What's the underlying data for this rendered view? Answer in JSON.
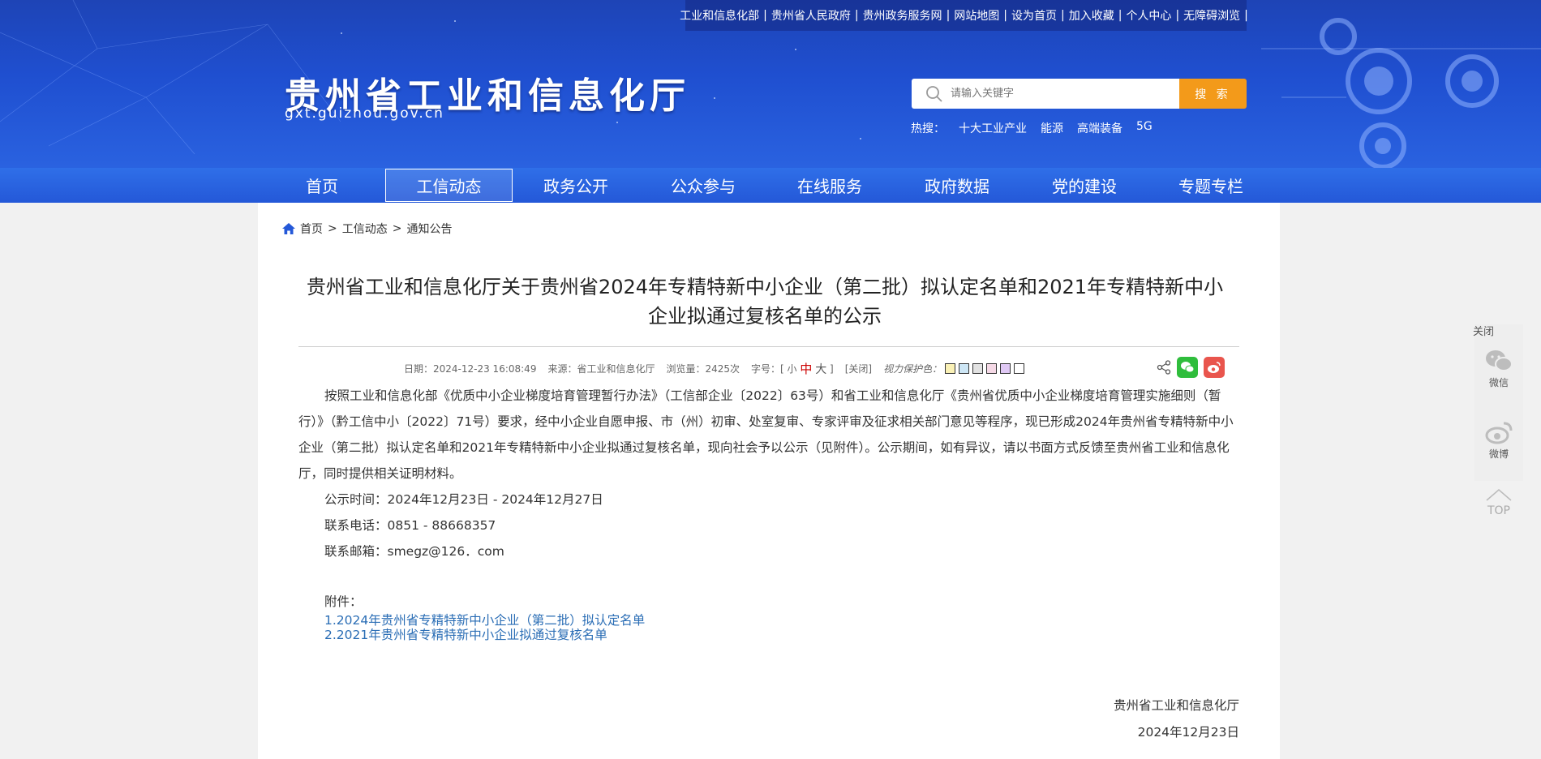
{
  "top_links": [
    "工业和信息化部",
    "贵州省人民政府",
    "贵州政务服务网",
    "网站地图",
    "设为首页",
    "加入收藏",
    "个人中心",
    "无障碍浏览"
  ],
  "top_link_sep": "|",
  "site": {
    "title": "贵州省工业和信息化厅",
    "domain": "gxt.guizhou.gov.cn"
  },
  "search": {
    "placeholder": "请输入关键字",
    "button": "搜 索"
  },
  "hot": {
    "label": "热搜：",
    "words": [
      "十大工业产业",
      "能源",
      "高端装备",
      "5G"
    ]
  },
  "nav": [
    "首页",
    "工信动态",
    "政务公开",
    "公众参与",
    "在线服务",
    "政府数据",
    "党的建设",
    "专题专栏"
  ],
  "nav_active_index": 1,
  "breadcrumb": {
    "home": "首页",
    "sep": ">",
    "level1": "工信动态",
    "level2": "通知公告"
  },
  "article": {
    "title": "贵州省工业和信息化厅关于贵州省2024年专精特新中小企业（第二批）拟认定名单和2021年专精特新中小企业拟通过复核名单的公示",
    "meta": {
      "date": "日期：2024-12-23 16:08:49",
      "source": "来源：省工业和信息化厅",
      "views": "浏览量：2425次",
      "font_label": "字号：[",
      "font_small": "小",
      "font_mid": "中",
      "font_big": "大",
      "font_end": "]",
      "close": "[关闭]",
      "eye_label": "视力保护色："
    },
    "eye_colors": [
      "#faf1b6",
      "#cde6f5",
      "#e2e2e2",
      "#f5d9e6",
      "#e0c9f5",
      "#ffffff"
    ],
    "paragraph": "按照工业和信息化部《优质中小企业梯度培育管理暂行办法》（工信部企业〔2022〕63号）和省工业和信息化厅《贵州省优质中小企业梯度培育管理实施细则（暂行）》（黔工信中小〔2022〕71号）要求，经中小企业自愿申报、市（州）初审、处室复审、专家评审及征求相关部门意见等程序，现已形成2024年贵州省专精特新中小企业（第二批）拟认定名单和2021年专精特新中小企业拟通过复核名单，现向社会予以公示（见附件）。公示期间，如有异议，请以书面方式反馈至贵州省工业和信息化厅，同时提供相关证明材料。",
    "period": "公示时间：2024年12月23日 - 2024年12月27日",
    "phone": "联系电话：0851 - 88668357",
    "email": "联系邮箱：smegz@126．com",
    "attachments_label": "附件：",
    "attachments": [
      "1.2024年贵州省专精特新中小企业（第二批）拟认定名单",
      "2.2021年贵州省专精特新中小企业拟通过复核名单"
    ],
    "signature": "贵州省工业和信息化厅",
    "sign_date": "2024年12月23日"
  },
  "float_bar": {
    "close": "关闭",
    "wechat": "微信",
    "weibo": "微博",
    "top": "TOP"
  }
}
